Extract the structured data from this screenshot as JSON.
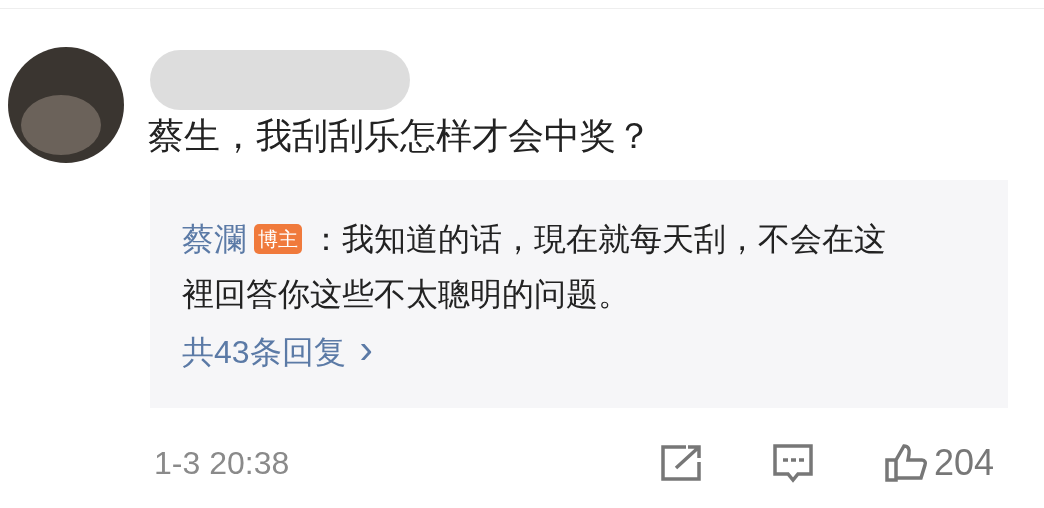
{
  "comment": {
    "text": "蔡生，我刮刮乐怎样才会中奖？",
    "time": "1-3 20:38",
    "likes": "204"
  },
  "reply": {
    "author": "蔡瀾",
    "badge": "博主",
    "text": "：我知道的话，現在就每天刮，不会在这裡回答你这些不太聰明的问题。",
    "more": "共43条回复",
    "more_arrow": "›"
  }
}
